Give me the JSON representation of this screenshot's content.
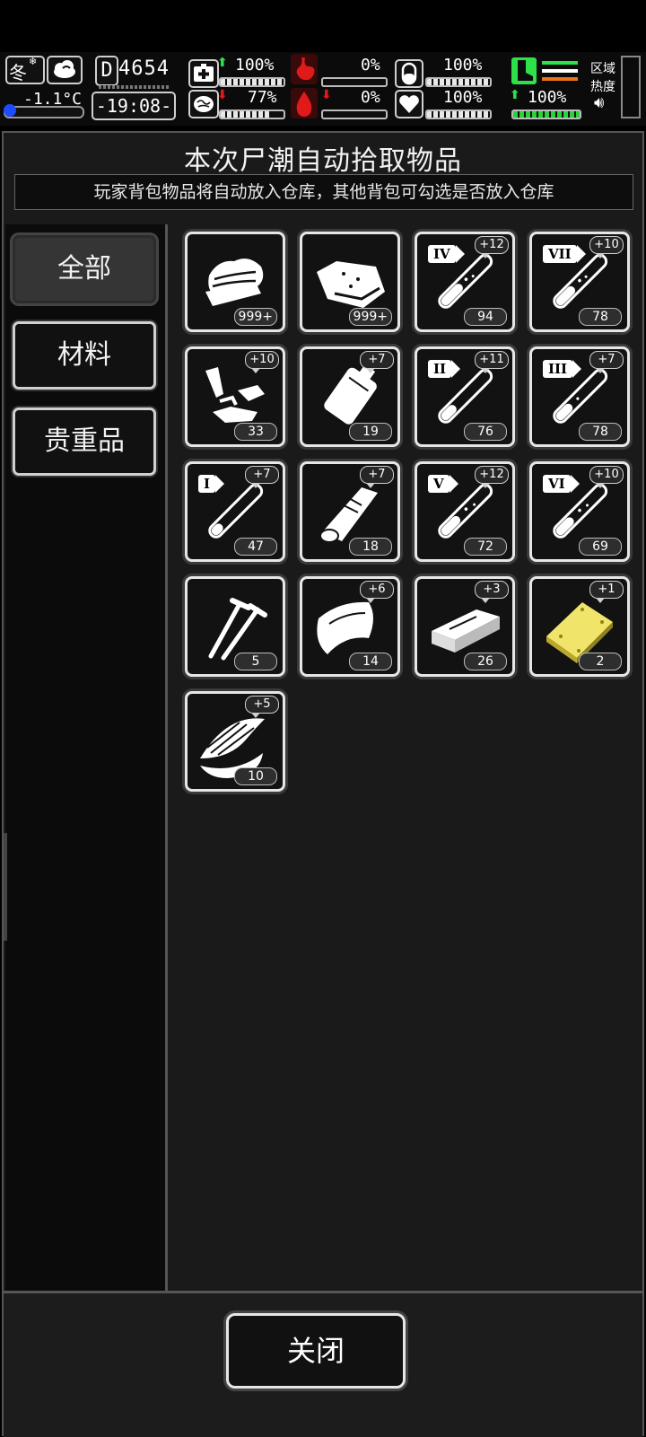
{
  "status": {
    "season": "冬",
    "temperature": "-1.1°C",
    "day_counter": "4654",
    "day_icon_char": "D",
    "clock": "-19:08-",
    "health": {
      "value": "100%",
      "trend": "up",
      "level": 1.0
    },
    "brain": {
      "value": "77%",
      "trend": "down",
      "level": 0.77
    },
    "stomach": {
      "value": "0%",
      "level": 0.0
    },
    "blood": {
      "value": "0%",
      "trend": "down",
      "level": 0.0
    },
    "pill": {
      "value": "100%",
      "level": 1.0
    },
    "heart": {
      "value": "100%",
      "level": 1.0
    },
    "stamina": {
      "value": "100%",
      "trend": "up",
      "level": 1.0
    },
    "zone_heat_label_1": "区域",
    "zone_heat_label_2": "热度",
    "colors": {
      "accent_green": "#2ee04a",
      "accent_red": "#e01a1a",
      "accent_orange": "#e8741c"
    }
  },
  "panel": {
    "title": "本次尸潮自动拾取物品",
    "subtitle": "玩家背包物品将自动放入仓库，其他背包可勾选是否放入仓库"
  },
  "tabs": [
    {
      "label": "全部",
      "active": true
    },
    {
      "label": "材料",
      "active": false
    },
    {
      "label": "贵重品",
      "active": false
    }
  ],
  "items": [
    {
      "icon": "cloth-icon",
      "count": "999+",
      "bonus": ""
    },
    {
      "icon": "raw-meat-icon",
      "count": "999+",
      "bonus": ""
    },
    {
      "icon": "syringe-iv-icon",
      "count": "94",
      "bonus": "+12",
      "roman": "IV"
    },
    {
      "icon": "syringe-vii-icon",
      "count": "78",
      "bonus": "+10",
      "roman": "VII"
    },
    {
      "icon": "scrap-parts-icon",
      "count": "33",
      "bonus": "+10"
    },
    {
      "icon": "blood-bag-icon",
      "count": "19",
      "bonus": "+7"
    },
    {
      "icon": "syringe-ii-icon",
      "count": "76",
      "bonus": "+11",
      "roman": "II"
    },
    {
      "icon": "syringe-iii-icon",
      "count": "78",
      "bonus": "+7",
      "roman": "III"
    },
    {
      "icon": "syringe-i-icon",
      "count": "47",
      "bonus": "+7",
      "roman": "I"
    },
    {
      "icon": "bandage-roll-icon",
      "count": "18",
      "bonus": "+7"
    },
    {
      "icon": "syringe-v-icon",
      "count": "72",
      "bonus": "+12",
      "roman": "V"
    },
    {
      "icon": "syringe-vi-icon",
      "count": "69",
      "bonus": "+10",
      "roman": "VI"
    },
    {
      "icon": "nails-icon",
      "count": "5",
      "bonus": ""
    },
    {
      "icon": "leather-icon",
      "count": "14",
      "bonus": "+6"
    },
    {
      "icon": "brick-icon",
      "count": "26",
      "bonus": "+3"
    },
    {
      "icon": "gold-plate-icon",
      "count": "2",
      "bonus": "+1"
    },
    {
      "icon": "herb-bundle-icon",
      "count": "10",
      "bonus": "+5"
    }
  ],
  "footer": {
    "close_label": "关闭"
  }
}
